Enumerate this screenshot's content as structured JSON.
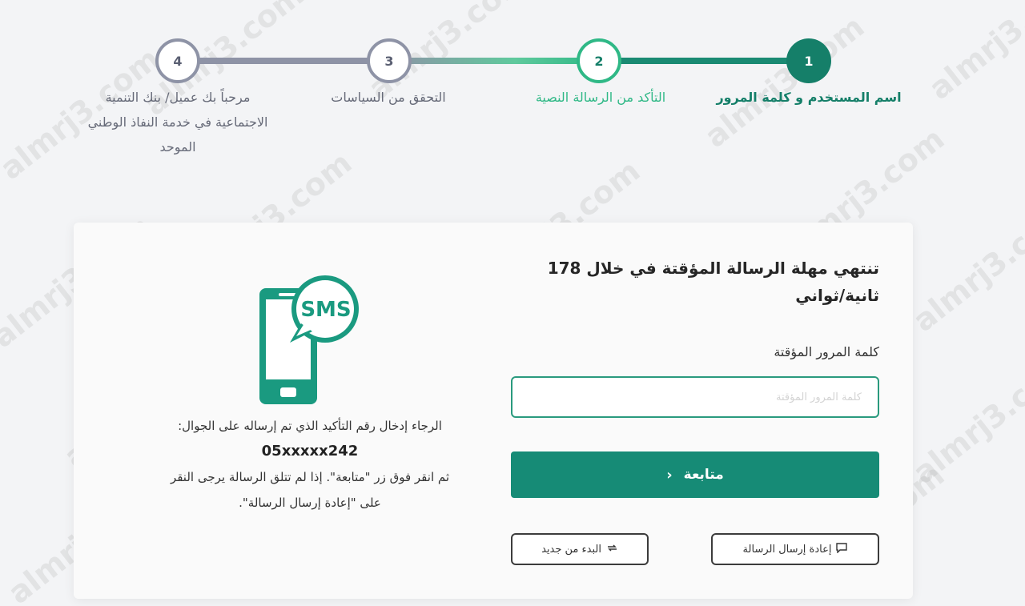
{
  "stepper": {
    "steps": [
      {
        "number": "1",
        "label": "اسم المستخدم و كلمة المرور"
      },
      {
        "number": "2",
        "label": "التأكد من الرسالة النصية"
      },
      {
        "number": "3",
        "label": "التحقق من السياسات"
      },
      {
        "number": "4",
        "label": "مرحباً بك عميل/ بنك التنمية الاجتماعية في خدمة النفاذ الوطني الموحد"
      }
    ]
  },
  "form": {
    "timer_text": "تنتهي مهلة الرسالة المؤقتة في خلال 178 ثانية/ثواني",
    "otp_label": "كلمة المرور المؤقتة",
    "otp_placeholder": "كلمة المرور المؤقتة",
    "otp_value": "",
    "continue_label": "متابعة",
    "resend_label": "إعادة إرسال الرسالة",
    "restart_label": "البدء من جديد"
  },
  "info": {
    "sms_badge": "SMS",
    "line1": "الرجاء إدخال رقم التأكيد الذي تم إرساله على الجوال:",
    "phone": "05xxxxx242",
    "line2": "ثم انقر فوق زر \"متابعة\". إذا لم تتلق الرسالة يرجى النقر على \"إعادة إرسال الرسالة\"."
  },
  "watermark": "almrj3.com",
  "colors": {
    "primary": "#168b76",
    "active_step": "#2fb886",
    "inactive_step": "#8e93a6"
  }
}
